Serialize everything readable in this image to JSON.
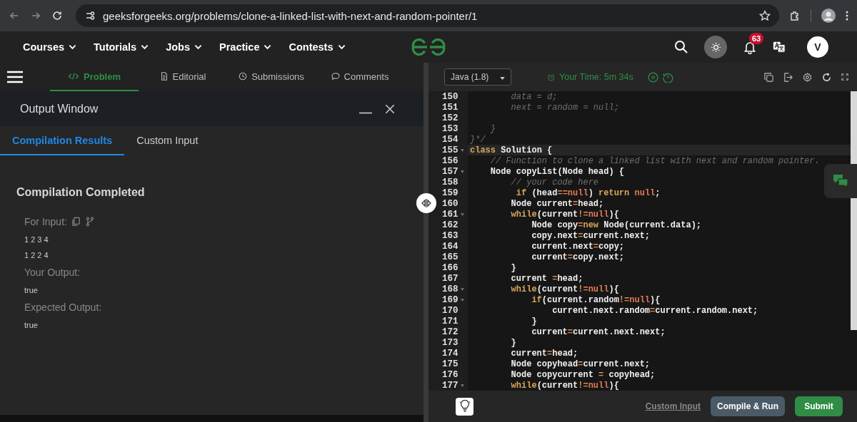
{
  "browser": {
    "url": "geeksforgeeks.org/problems/clone-a-linked-list-with-next-and-random-pointer/1"
  },
  "nav": {
    "items": [
      {
        "label": "Courses"
      },
      {
        "label": "Tutorials"
      },
      {
        "label": "Jobs"
      },
      {
        "label": "Practice"
      },
      {
        "label": "Contests"
      }
    ],
    "notification_count": "63",
    "avatar": "V"
  },
  "problem_tabs": [
    {
      "label": "Problem",
      "kind": "code",
      "selected": true
    },
    {
      "label": "Editorial",
      "kind": "document",
      "selected": false
    },
    {
      "label": "Submissions",
      "kind": "clock",
      "selected": false
    },
    {
      "label": "Comments",
      "kind": "chat",
      "selected": false
    }
  ],
  "output_window": {
    "title": "Output Window",
    "tabs": [
      {
        "label": "Compilation Results",
        "selected": true
      },
      {
        "label": "Custom Input",
        "selected": false
      }
    ],
    "status": "Compilation Completed",
    "sections": [
      {
        "label": "For Input:",
        "copyable": true,
        "values": [
          "1 2 3 4",
          "1 2 2 4"
        ]
      },
      {
        "label": "Your Output:",
        "copyable": false,
        "values": [
          "true"
        ]
      },
      {
        "label": "Expected Output:",
        "copyable": false,
        "values": [
          "true"
        ]
      }
    ]
  },
  "editor_toolbar": {
    "language": "Java (1.8)",
    "timer": "Your Time: 5m 34s"
  },
  "code": {
    "lines": [
      {
        "n": "150",
        "fold": false,
        "highlighted": false,
        "tokens": [
          {
            "kind": "comment",
            "text": "        data = d;"
          }
        ]
      },
      {
        "n": "151",
        "fold": false,
        "highlighted": false,
        "tokens": [
          {
            "kind": "comment",
            "text": "        next = random = null;"
          }
        ]
      },
      {
        "n": "152",
        "fold": false,
        "highlighted": false
      },
      {
        "n": "153",
        "fold": false,
        "highlighted": false,
        "tokens": [
          {
            "kind": "comment",
            "text": "    }"
          }
        ]
      },
      {
        "n": "154",
        "fold": false,
        "highlighted": false,
        "tokens": [
          {
            "kind": "comment",
            "text": "}*/"
          }
        ]
      },
      {
        "n": "155",
        "fold": true,
        "highlighted": true,
        "tokens": [
          {
            "kind": "keyword",
            "text": "class"
          },
          {
            "kind": "plain",
            "text": " Solution {"
          }
        ]
      },
      {
        "n": "156",
        "fold": false,
        "highlighted": false,
        "tokens": [
          {
            "kind": "comment",
            "text": "    // Function to clone a linked list with next and random pointer."
          }
        ]
      },
      {
        "n": "157",
        "fold": true,
        "highlighted": false,
        "tokens": [
          {
            "kind": "plain",
            "text": "    Node copyList(Node head) {"
          }
        ]
      },
      {
        "n": "158",
        "fold": false,
        "highlighted": false,
        "tokens": [
          {
            "kind": "comment",
            "text": "        // your code here"
          }
        ]
      },
      {
        "n": "159",
        "fold": false,
        "highlighted": false,
        "tokens": [
          {
            "kind": "keyword",
            "text": "         if"
          },
          {
            "kind": "plain",
            "text": " (head"
          },
          {
            "kind": "operator",
            "text": "=="
          },
          {
            "kind": "literal",
            "text": "null"
          },
          {
            "kind": "plain",
            "text": ") "
          },
          {
            "kind": "keyword",
            "text": "return "
          },
          {
            "kind": "literal",
            "text": "null"
          },
          {
            "kind": "plain",
            "text": ";"
          }
        ]
      },
      {
        "n": "160",
        "fold": false,
        "highlighted": false,
        "tokens": [
          {
            "kind": "plain",
            "text": "        Node current"
          },
          {
            "kind": "operator",
            "text": "="
          },
          {
            "kind": "plain",
            "text": "head;"
          }
        ]
      },
      {
        "n": "161",
        "fold": true,
        "highlighted": false,
        "tokens": [
          {
            "kind": "keyword",
            "text": "        while"
          },
          {
            "kind": "plain",
            "text": "(current"
          },
          {
            "kind": "operator",
            "text": "!="
          },
          {
            "kind": "literal",
            "text": "null"
          },
          {
            "kind": "plain",
            "text": "){"
          }
        ]
      },
      {
        "n": "162",
        "fold": false,
        "highlighted": false,
        "tokens": [
          {
            "kind": "plain",
            "text": "            Node copy"
          },
          {
            "kind": "operator",
            "text": "="
          },
          {
            "kind": "keyword",
            "text": "new"
          },
          {
            "kind": "plain",
            "text": " Node(current.data);"
          }
        ]
      },
      {
        "n": "163",
        "fold": false,
        "highlighted": false,
        "tokens": [
          {
            "kind": "plain",
            "text": "            copy.next"
          },
          {
            "kind": "operator",
            "text": "="
          },
          {
            "kind": "plain",
            "text": "current.next;"
          }
        ]
      },
      {
        "n": "164",
        "fold": false,
        "highlighted": false,
        "tokens": [
          {
            "kind": "plain",
            "text": "            current.next"
          },
          {
            "kind": "operator",
            "text": "="
          },
          {
            "kind": "plain",
            "text": "copy;"
          }
        ]
      },
      {
        "n": "165",
        "fold": false,
        "highlighted": false,
        "tokens": [
          {
            "kind": "plain",
            "text": "            current"
          },
          {
            "kind": "operator",
            "text": "="
          },
          {
            "kind": "plain",
            "text": "copy.next;"
          }
        ]
      },
      {
        "n": "166",
        "fold": false,
        "highlighted": false,
        "tokens": [
          {
            "kind": "plain",
            "text": "        }"
          }
        ]
      },
      {
        "n": "167",
        "fold": false,
        "highlighted": false,
        "tokens": [
          {
            "kind": "plain",
            "text": "        current "
          },
          {
            "kind": "operator",
            "text": "="
          },
          {
            "kind": "plain",
            "text": "head;"
          }
        ]
      },
      {
        "n": "168",
        "fold": true,
        "highlighted": false,
        "tokens": [
          {
            "kind": "keyword",
            "text": "        while"
          },
          {
            "kind": "plain",
            "text": "(current"
          },
          {
            "kind": "operator",
            "text": "!="
          },
          {
            "kind": "literal",
            "text": "null"
          },
          {
            "kind": "plain",
            "text": "){"
          }
        ]
      },
      {
        "n": "169",
        "fold": true,
        "highlighted": false,
        "tokens": [
          {
            "kind": "keyword",
            "text": "            if"
          },
          {
            "kind": "plain",
            "text": "(current.random"
          },
          {
            "kind": "operator",
            "text": "!="
          },
          {
            "kind": "literal",
            "text": "null"
          },
          {
            "kind": "plain",
            "text": "){"
          }
        ]
      },
      {
        "n": "170",
        "fold": false,
        "highlighted": false,
        "tokens": [
          {
            "kind": "plain",
            "text": "                current.next.random"
          },
          {
            "kind": "operator",
            "text": "="
          },
          {
            "kind": "plain",
            "text": "current.random.next;"
          }
        ]
      },
      {
        "n": "171",
        "fold": false,
        "highlighted": false,
        "tokens": [
          {
            "kind": "plain",
            "text": "            }"
          }
        ]
      },
      {
        "n": "172",
        "fold": false,
        "highlighted": false,
        "tokens": [
          {
            "kind": "plain",
            "text": "            current"
          },
          {
            "kind": "operator",
            "text": "="
          },
          {
            "kind": "plain",
            "text": "current.next.next;"
          }
        ]
      },
      {
        "n": "173",
        "fold": false,
        "highlighted": false,
        "tokens": [
          {
            "kind": "plain",
            "text": "        }"
          }
        ]
      },
      {
        "n": "174",
        "fold": false,
        "highlighted": false,
        "tokens": [
          {
            "kind": "plain",
            "text": "        current"
          },
          {
            "kind": "operator",
            "text": "="
          },
          {
            "kind": "plain",
            "text": "head;"
          }
        ]
      },
      {
        "n": "175",
        "fold": false,
        "highlighted": false,
        "tokens": [
          {
            "kind": "plain",
            "text": "        Node copyhead"
          },
          {
            "kind": "operator",
            "text": "="
          },
          {
            "kind": "plain",
            "text": "current.next;"
          }
        ]
      },
      {
        "n": "176",
        "fold": false,
        "highlighted": false,
        "tokens": [
          {
            "kind": "plain",
            "text": "        Node copycurrent "
          },
          {
            "kind": "operator",
            "text": "="
          },
          {
            "kind": "plain",
            "text": " copyhead;"
          }
        ]
      },
      {
        "n": "177",
        "fold": true,
        "highlighted": false,
        "tokens": [
          {
            "kind": "keyword",
            "text": "        while"
          },
          {
            "kind": "plain",
            "text": "(current"
          },
          {
            "kind": "operator",
            "text": "!="
          },
          {
            "kind": "literal",
            "text": "null"
          },
          {
            "kind": "plain",
            "text": "){"
          }
        ]
      }
    ]
  },
  "actions": {
    "custom_input": "Custom Input",
    "compile": "Compile & Run",
    "submit": "Submit"
  }
}
